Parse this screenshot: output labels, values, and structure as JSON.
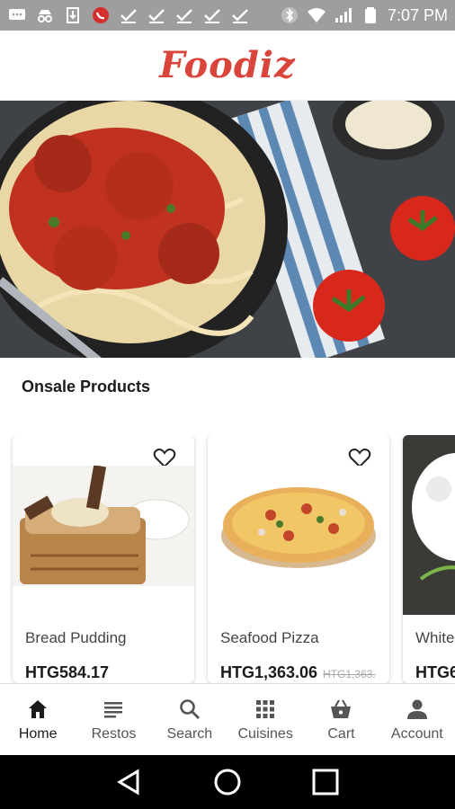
{
  "status_bar": {
    "time": "7:07 PM",
    "icons": [
      "message-icon",
      "incognito-icon",
      "download-icon",
      "missed-call-icon",
      "check-icon",
      "check-icon",
      "check-icon",
      "check-icon",
      "check-icon",
      "bluetooth-icon",
      "wifi-icon",
      "signal-icon",
      "battery-icon"
    ]
  },
  "header": {
    "logo": "Foodiz"
  },
  "hero": {
    "alt": "spaghetti-with-meatballs"
  },
  "section": {
    "title": "Onsale Products"
  },
  "products": [
    {
      "name": "Bread Pudding",
      "price": "HTG584.17",
      "old_price": ""
    },
    {
      "name": "Seafood Pizza",
      "price": "HTG1,363.06",
      "old_price": "HTG1,363."
    },
    {
      "name": "White",
      "price": "HTG6",
      "old_price": ""
    }
  ],
  "nav": {
    "items": [
      {
        "label": "Home",
        "icon": "home-icon"
      },
      {
        "label": "Restos",
        "icon": "list-icon"
      },
      {
        "label": "Search",
        "icon": "search-icon"
      },
      {
        "label": "Cuisines",
        "icon": "grid-icon"
      },
      {
        "label": "Cart",
        "icon": "basket-icon"
      },
      {
        "label": "Account",
        "icon": "person-icon"
      }
    ]
  },
  "colors": {
    "brand": "#d9453b",
    "status_bar": "#9e9e9e",
    "text": "#1b1b1b"
  }
}
